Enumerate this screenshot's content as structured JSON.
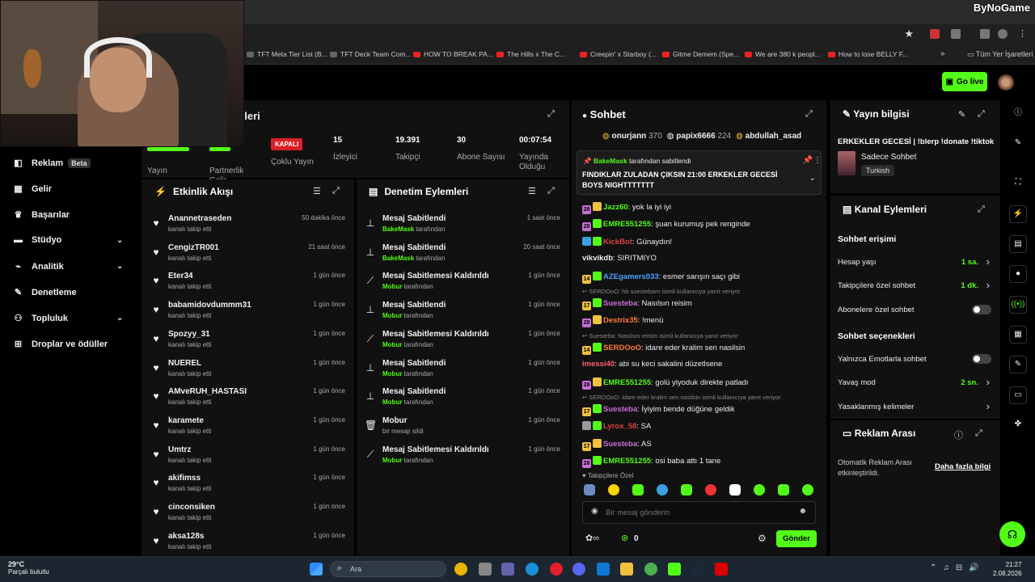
{
  "watermark": "ByNoGame",
  "bookmarks": [
    {
      "label": "TFT Meta Tier List (B...",
      "icon": "doc-favicon"
    },
    {
      "label": "TFT Deck Team Com...",
      "icon": "doc-favicon"
    },
    {
      "label": "HOW TO BREAK PA...",
      "icon": "youtube-favicon"
    },
    {
      "label": "The Hills x The C...",
      "icon": "youtube-favicon"
    },
    {
      "label": "Creepin' x Starboy (...",
      "icon": "youtube-favicon"
    },
    {
      "label": "Gitme Demem (Spe...",
      "icon": "youtube-favicon"
    },
    {
      "label": "We are 380 k peopl...",
      "icon": "youtube-favicon"
    },
    {
      "label": "How to lose BELLY F...",
      "icon": "youtube-favicon"
    }
  ],
  "bookmarks_folder": "Tüm Yer İşaretleri",
  "header": {
    "go_live": "Go live"
  },
  "nav": [
    {
      "label": "Reklam",
      "badge": "Beta",
      "icon": "megaphone-icon"
    },
    {
      "label": "Gelir",
      "icon": "chart-icon"
    },
    {
      "label": "Başarılar",
      "icon": "trophy-icon"
    },
    {
      "label": "Stüdyo",
      "icon": "film-icon",
      "expand": true
    },
    {
      "label": "Analitik",
      "icon": "analytics-icon",
      "expand": true
    },
    {
      "label": "Denetleme",
      "icon": "wrench-icon"
    },
    {
      "label": "Topluluk",
      "icon": "people-icon",
      "expand": true
    },
    {
      "label": "Droplar ve ödüller",
      "icon": "gift-icon"
    }
  ],
  "stats": {
    "title_fragment": "eleri",
    "items": [
      {
        "label": "Yayın",
        "value": ""
      },
      {
        "label": "Partnerlik Gelir",
        "value": ""
      },
      {
        "label": "Çoklu Yayın",
        "value": "KAPALI"
      },
      {
        "label": "İzleyici",
        "value": "15"
      },
      {
        "label": "Takipçi",
        "value": "19.391"
      },
      {
        "label": "Abone Sayısı",
        "value": "30"
      },
      {
        "label": "Yayında Olduğu",
        "value": "00:07:54"
      }
    ]
  },
  "activity": {
    "title": "Etkinlik Akışı",
    "items": [
      {
        "name": "Anannetraseden",
        "sub": "kanalı takip etti",
        "time": "50 dakika önce"
      },
      {
        "name": "CengizTR001",
        "sub": "kanalı takip etti",
        "time": "21 saat önce"
      },
      {
        "name": "Eter34",
        "sub": "kanalı takip etti",
        "time": "1 gün önce"
      },
      {
        "name": "babamidovdummm31",
        "sub": "kanalı takip etti",
        "time": "1 gün önce"
      },
      {
        "name": "Spozyy_31",
        "sub": "kanalı takip etti",
        "time": "1 gün önce"
      },
      {
        "name": "NUEREL",
        "sub": "kanalı takip etti",
        "time": "1 gün önce"
      },
      {
        "name": "AMveRUH_HASTASI",
        "sub": "kanalı takip etti",
        "time": "1 gün önce"
      },
      {
        "name": "karamete",
        "sub": "kanalı takip etti",
        "time": "1 gün önce"
      },
      {
        "name": "Umtrz",
        "sub": "kanalı takip etti",
        "time": "1 gün önce"
      },
      {
        "name": "akifimss",
        "sub": "kanalı takip etti",
        "time": "1 gün önce"
      },
      {
        "name": "cinconsiken",
        "sub": "kanalı takip etti",
        "time": "1 gün önce"
      },
      {
        "name": "aksa128s",
        "sub": "kanalı takip etti",
        "time": "1 gün önce"
      }
    ]
  },
  "moderation": {
    "title": "Denetim Eylemleri",
    "items": [
      {
        "action": "Mesaj Sabitlendi",
        "by": "BakeMask",
        "suffix": "tarafından",
        "time": "1 saat önce",
        "icon": "pin-icon"
      },
      {
        "action": "Mesaj Sabitlendi",
        "by": "BakeMask",
        "suffix": "tarafından",
        "time": "20 saat önce",
        "icon": "pin-icon"
      },
      {
        "action": "Mesaj Sabitlemesi Kaldırıldı",
        "by": "Mobur",
        "suffix": "tarafından",
        "time": "1 gün önce",
        "icon": "unpin-icon"
      },
      {
        "action": "Mesaj Sabitlendi",
        "by": "Mobur",
        "suffix": "tarafından",
        "time": "1 gün önce",
        "icon": "pin-icon"
      },
      {
        "action": "Mesaj Sabitlemesi Kaldırıldı",
        "by": "Mobur",
        "suffix": "tarafından",
        "time": "1 gün önce",
        "icon": "unpin-icon"
      },
      {
        "action": "Mesaj Sabitlendi",
        "by": "Mobur",
        "suffix": "tarafından",
        "time": "1 gün önce",
        "icon": "pin-icon"
      },
      {
        "action": "Mesaj Sabitlendi",
        "by": "Mobur",
        "suffix": "tarafından",
        "time": "1 gün önce",
        "icon": "pin-icon"
      },
      {
        "action": "Mobur",
        "by": "",
        "suffix": "bir mesajı sildi",
        "time": "1 gün önce",
        "icon": "trash-icon"
      },
      {
        "action": "Mesaj Sabitlemesi Kaldırıldı",
        "by": "Mobur",
        "suffix": "tarafından",
        "time": "1 gün önce",
        "icon": "unpin-icon"
      }
    ]
  },
  "chat": {
    "title": "Sohbet",
    "leaders": [
      {
        "name": "onurjann",
        "count": "370",
        "color": "#f0c040"
      },
      {
        "name": "papix6666",
        "count": "224",
        "color": "#ffffff"
      },
      {
        "name": "abdullah_asad",
        "count": "",
        "color": "#f0c040"
      }
    ],
    "pinned_by_user": "BakeMask",
    "pinned_by_suffix": "tarafından sabitlendi",
    "pinned_text": "FINDIKLAR ZULADAN ÇIKSIN 21:00 ERKEKLER GECESİ BOYS NIGHTTTTTTT",
    "messages": [
      {
        "user": "Jazz60",
        "color": "#53fc18",
        "text": ": yok la iyi iyi",
        "badge": "28",
        "badgeColor": "#c86fd6"
      },
      {
        "user": "EMRE551255",
        "color": "#53fc18",
        "text": ": şuan kurumuş pek renginde",
        "badge": "28",
        "badgeColor": "#c86fd6"
      },
      {
        "user": "KickBot",
        "color": "#d94040",
        "text": ": Günaydın!",
        "badge": "",
        "badgeColor": "#3aa0e0"
      },
      {
        "user": "vikvikdb",
        "color": "#eeeeee",
        "text": ": SIRITMIYO",
        "badge": "",
        "badgeColor": ""
      },
      {
        "user": "AZEgamers033",
        "color": "#4aa3ff",
        "text": ": esmer sarışın saçı gibi",
        "badge": "14",
        "badgeColor": "#f0c040"
      },
      {
        "user": "Suesteba",
        "color": "#c86fd6",
        "text": ": Nasılsın reisim",
        "badge": "17",
        "badgeColor": "#f0c040",
        "reply": "SERDOoO: hb suestebam isimli kullanıcıya yanıt veriyor"
      },
      {
        "user": "Destrix35",
        "color": "#ff7a3a",
        "text": ": !menü",
        "badge": "28",
        "badgeColor": "#c86fd6"
      },
      {
        "user": "SERDOoO",
        "color": "#ff7a3a",
        "text": ": idare eder kralim sen nasilsin",
        "badge": "14",
        "badgeColor": "#f0c040",
        "reply": "Suesteba: Nasılsın reisim isimli kullanıcıya yanıt veriyor"
      },
      {
        "user": "imessi40",
        "color": "#ff6070",
        "text": ": abi su keci sakalini düzetlsene",
        "badge": "",
        "badgeColor": ""
      },
      {
        "user": "EMRE551255",
        "color": "#53fc18",
        "text": ": golü yiyoduk direkte patladı",
        "badge": "28",
        "badgeColor": "#c86fd6"
      },
      {
        "user": "Suesteba",
        "color": "#c86fd6",
        "text": ": İyiyim bende düğüne geldik",
        "badge": "17",
        "badgeColor": "#f0c040",
        "reply": "SERDOoO: idare eder kralim sen nasilsin isimli kullanıcıya yanıt veriyor"
      },
      {
        "user": "Lyrox_58",
        "color": "#d94040",
        "text": ": SA",
        "badge": "",
        "badgeColor": "#999999"
      },
      {
        "user": "Suesteba",
        "color": "#c86fd6",
        "text": ": AS",
        "badge": "17",
        "badgeColor": "#f0c040"
      },
      {
        "user": "EMRE551255",
        "color": "#53fc18",
        "text": ": osi baba attı 1 tane",
        "badge": "28",
        "badgeColor": "#c86fd6"
      }
    ],
    "emotes_label": "Takipçilere Özel",
    "input_placeholder": "Bir mesaj gönderin",
    "send": "Gönder",
    "points": "0"
  },
  "stream_info": {
    "title": "Yayın bilgisi",
    "stream_title": "ERKEKLER GECESİ | !blerp !donate !tiktok",
    "category": "Sadece Sohbet",
    "language": "Turkish"
  },
  "channel_actions": {
    "title": "Kanal Eylemleri",
    "chat_access": "Sohbet erişimi",
    "rows1": [
      {
        "label": "Hesap yaşı",
        "value": "1 sa.",
        "type": "arrow"
      },
      {
        "label": "Takipçilere özel sohbet",
        "value": "1 dk.",
        "type": "arrow"
      },
      {
        "label": "Abonelere özel sohbet",
        "value": "",
        "type": "toggle"
      }
    ],
    "chat_options": "Sohbet seçenekleri",
    "rows2": [
      {
        "label": "Yalnızca Emotlarla sohbet",
        "value": "",
        "type": "toggle"
      },
      {
        "label": "Yavaş mod",
        "value": "2 sn.",
        "type": "arrow"
      },
      {
        "label": "Yasaklanmış kelimeler",
        "value": "",
        "type": "arrow"
      }
    ]
  },
  "ad_break": {
    "title": "Reklam Arası",
    "text": "Otomatik Reklam Arası etkinleştirildi.",
    "link": "Daha fazla bilgi"
  },
  "taskbar": {
    "temp": "29°C",
    "weather": "Parçalı bulutlu",
    "search": "Ara",
    "time": "21:27",
    "date": "2.08.2026"
  }
}
